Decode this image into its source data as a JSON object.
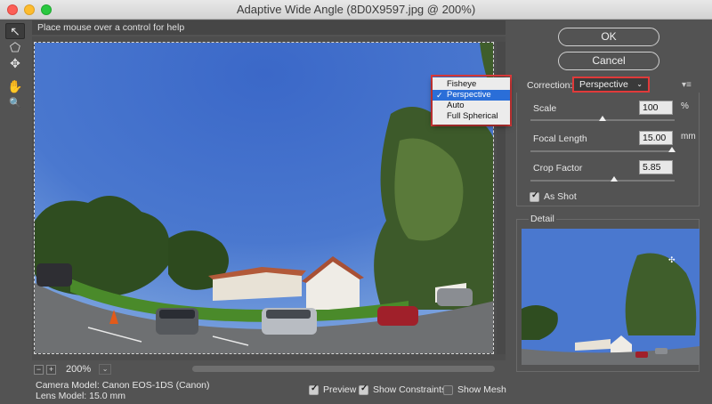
{
  "window": {
    "title": "Adaptive Wide Angle (8D0X9597.jpg @ 200%)"
  },
  "help_text": "Place mouse over a control for help",
  "tools": [
    {
      "name": "constraint-tool-icon",
      "glyph": "↖"
    },
    {
      "name": "polygon-constraint-tool-icon",
      "glyph": "⬠"
    },
    {
      "name": "move-tool-icon",
      "glyph": "✥"
    },
    {
      "name": "hand-tool-icon",
      "glyph": "✋"
    },
    {
      "name": "zoom-tool-icon",
      "glyph": "🔍"
    }
  ],
  "buttons": {
    "ok": "OK",
    "cancel": "Cancel"
  },
  "correction": {
    "label": "Correction:",
    "selected": "Perspective",
    "options": [
      "Fisheye",
      "Perspective",
      "Auto",
      "Full Spherical"
    ]
  },
  "params": {
    "scale": {
      "label": "Scale",
      "value": "100",
      "unit": "%",
      "position_fraction": 0.5
    },
    "focal_length": {
      "label": "Focal Length",
      "value": "15.00",
      "unit": "mm",
      "position_fraction": 0.98
    },
    "crop_factor": {
      "label": "Crop Factor",
      "value": "5.85",
      "unit": "",
      "position_fraction": 0.58
    }
  },
  "as_shot": {
    "label": "As Shot",
    "checked": true
  },
  "detail": {
    "label": "Detail"
  },
  "zoom": {
    "minus": "−",
    "plus": "+",
    "value": "200%"
  },
  "info": {
    "camera_model": "Camera Model: Canon EOS-1DS (Canon)",
    "lens_model": "Lens Model: 15.0 mm"
  },
  "view_options": {
    "preview": {
      "label": "Preview",
      "checked": true
    },
    "show_constraints": {
      "label": "Show Constraints",
      "checked": true
    },
    "show_mesh": {
      "label": "Show Mesh",
      "checked": false
    }
  },
  "colors": {
    "highlight_red": "#e03a3a",
    "menu_selection": "#2a6ed8"
  }
}
